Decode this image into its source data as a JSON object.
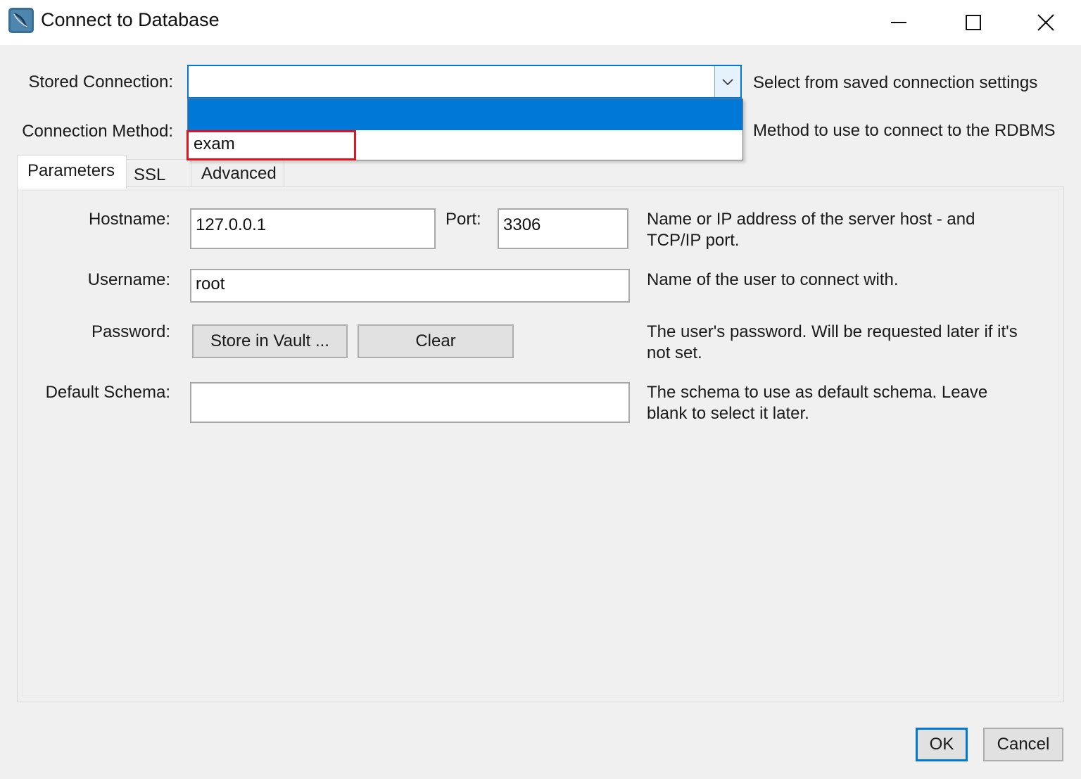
{
  "window": {
    "title": "Connect to Database",
    "app_icon": "mysql-workbench-dolphin-icon",
    "controls": [
      "minimize-icon",
      "maximize-icon",
      "close-icon"
    ]
  },
  "stored_connection": {
    "label": "Stored Connection:",
    "value": "",
    "help": "Select from saved connection settings",
    "dropdown_items": [
      "",
      "exam"
    ],
    "highlighted_item": "exam"
  },
  "connection_method": {
    "label": "Connection Method:",
    "help": "Method to use to connect to the RDBMS"
  },
  "tabs": [
    {
      "label": "Parameters",
      "active": true
    },
    {
      "label": "SSL",
      "active": false
    },
    {
      "label": "Advanced",
      "active": false
    }
  ],
  "params": {
    "hostname": {
      "label": "Hostname:",
      "value": "127.0.0.1"
    },
    "port": {
      "label": "Port:",
      "value": "3306"
    },
    "hostname_help": "Name or IP address of the server host - and TCP/IP port.",
    "username": {
      "label": "Username:",
      "value": "root",
      "help": "Name of the user to connect with."
    },
    "password": {
      "label": "Password:",
      "store_button": "Store in Vault ...",
      "clear_button": "Clear",
      "help": "The user's password. Will be requested later if it's not set."
    },
    "schema": {
      "label": "Default Schema:",
      "value": "",
      "help": "The schema to use as default schema. Leave blank to select it later."
    }
  },
  "footer": {
    "ok": "OK",
    "cancel": "Cancel"
  },
  "colors": {
    "accent": "#0078d7",
    "highlight_border": "#e8101a"
  }
}
